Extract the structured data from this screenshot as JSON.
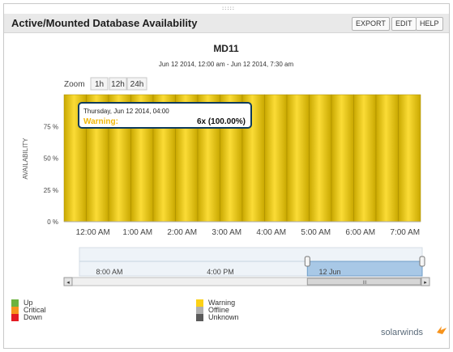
{
  "header": {
    "title": "Active/Mounted Database Availability",
    "buttons": [
      "EXPORT",
      "EDIT",
      "HELP"
    ]
  },
  "chart_meta": {
    "title": "MD11",
    "subtitle": "Jun 12 2014, 12:00 am - Jun 12 2014, 7:30 am",
    "zoom_label": "Zoom",
    "zoom_options": [
      "1h",
      "12h",
      "24h"
    ],
    "ylabel": "AVAILABILITY",
    "tooltip": {
      "date": "Thursday, Jun 12 2014, 04:00",
      "label": "Warning:",
      "value": "6x (100.00%)"
    },
    "navigator": {
      "ticks": [
        "8:00 AM",
        "4:00 PM",
        "12 Jun"
      ],
      "scroll_grip": "III",
      "selection_start_fraction": 0.665,
      "selection_end_fraction": 1.0
    }
  },
  "chart_data": {
    "type": "bar",
    "categories": [
      "12:00 AM",
      "12:30 AM",
      "1:00 AM",
      "1:30 AM",
      "2:00 AM",
      "2:30 AM",
      "3:00 AM",
      "3:30 AM",
      "4:00 AM",
      "4:30 AM",
      "5:00 AM",
      "5:30 AM",
      "6:00 AM",
      "6:30 AM",
      "7:00 AM",
      "7:30 AM"
    ],
    "x_tick_labels": [
      "12:00 AM",
      "1:00 AM",
      "2:00 AM",
      "3:00 AM",
      "4:00 AM",
      "5:00 AM",
      "6:00 AM",
      "7:00 AM"
    ],
    "series": [
      {
        "name": "Warning",
        "values": [
          100,
          100,
          100,
          100,
          100,
          100,
          100,
          100,
          100,
          100,
          100,
          100,
          100,
          100,
          100,
          100
        ]
      }
    ],
    "yticks": [
      "0 %",
      "25 %",
      "50 %",
      "75 %"
    ],
    "ylim": [
      0,
      100
    ],
    "grid": false
  },
  "legend": [
    {
      "label": "Up",
      "color": "#6cb33f"
    },
    {
      "label": "Critical",
      "color": "#f7941d"
    },
    {
      "label": "Down",
      "color": "#e31b23"
    },
    {
      "label": "Warning",
      "color": "#fcd116"
    },
    {
      "label": "Offline",
      "color": "#b0b0b0"
    },
    {
      "label": "Unknown",
      "color": "#5a5a5a"
    }
  ],
  "brand": "solarwinds",
  "colors": {
    "bar_light": "#fbdc36",
    "bar_dark": "#c9a800",
    "navigator_fill": "#a8c8e6",
    "tooltip_border": "#0f3b5c",
    "tooltip_label": "#f2b705"
  }
}
